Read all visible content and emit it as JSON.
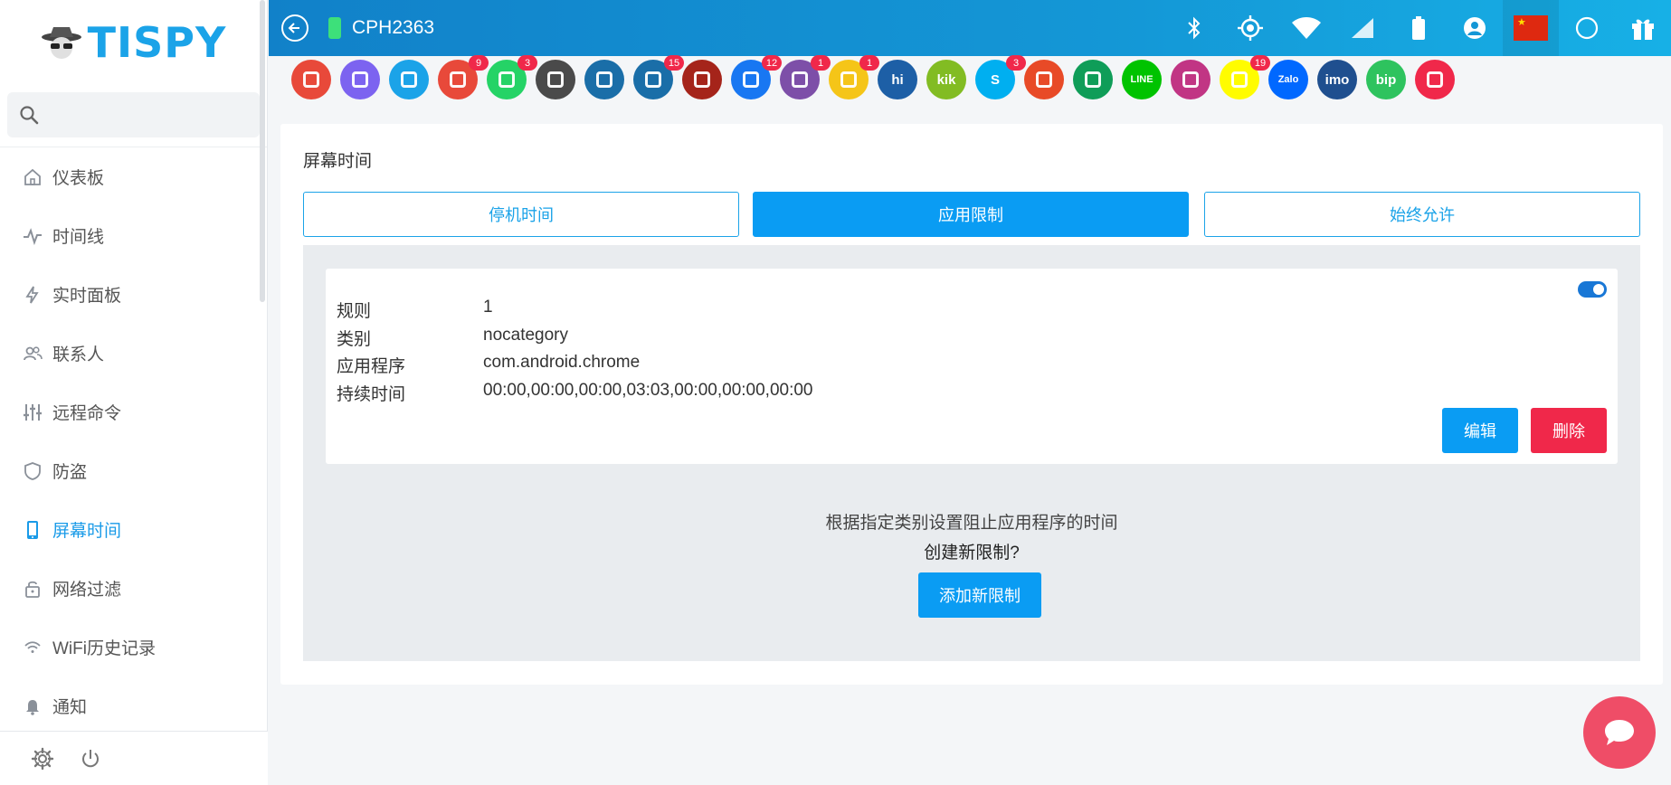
{
  "brand": {
    "name": "TISPY"
  },
  "search": {
    "placeholder": ""
  },
  "sidebar": {
    "items": [
      {
        "label": "仪表板",
        "icon": "home-icon"
      },
      {
        "label": "时间线",
        "icon": "pulse-icon"
      },
      {
        "label": "实时面板",
        "icon": "bolt-icon"
      },
      {
        "label": "联系人",
        "icon": "contacts-icon"
      },
      {
        "label": "远程命令",
        "icon": "sliders-icon"
      },
      {
        "label": "防盗",
        "icon": "shield-icon"
      },
      {
        "label": "屏幕时间",
        "icon": "phone-icon",
        "active": true
      },
      {
        "label": "网络过滤",
        "icon": "lock-icon"
      },
      {
        "label": "WiFi历史记录",
        "icon": "wifi-icon"
      },
      {
        "label": "通知",
        "icon": "bell-icon"
      }
    ]
  },
  "topbar": {
    "device_name": "CPH2363"
  },
  "apps": [
    {
      "name": "video-call",
      "color": "#e8493a",
      "badge": ""
    },
    {
      "name": "phone",
      "color": "#7c63f0",
      "badge": ""
    },
    {
      "name": "messages",
      "color": "#1ba3e8",
      "badge": ""
    },
    {
      "name": "photos",
      "color": "#e8493a",
      "badge": "9"
    },
    {
      "name": "whatsapp",
      "color": "#25d366",
      "badge": "3"
    },
    {
      "name": "keyboard",
      "color": "#4a4a4a",
      "badge": ""
    },
    {
      "name": "device",
      "color": "#1a6ea8",
      "badge": ""
    },
    {
      "name": "notifications",
      "color": "#1a6ea8",
      "badge": "15"
    },
    {
      "name": "browser",
      "color": "#a5241a",
      "badge": ""
    },
    {
      "name": "facebook",
      "color": "#1877f2",
      "badge": "12"
    },
    {
      "name": "viber",
      "color": "#7d4fa8",
      "badge": "1"
    },
    {
      "name": "email",
      "color": "#f5c518",
      "badge": "1"
    },
    {
      "name": "hike",
      "color": "#1d5fa6",
      "badge": "",
      "text": "hi"
    },
    {
      "name": "kik",
      "color": "#82bc23",
      "badge": "",
      "text": "kik"
    },
    {
      "name": "skype",
      "color": "#00aff0",
      "badge": "3",
      "text": "S"
    },
    {
      "name": "tinder",
      "color": "#e84a27",
      "badge": ""
    },
    {
      "name": "hangouts",
      "color": "#0f9d58",
      "badge": ""
    },
    {
      "name": "line",
      "color": "#00c300",
      "badge": "",
      "text": "LINE"
    },
    {
      "name": "instagram",
      "color": "#c13584",
      "badge": ""
    },
    {
      "name": "snapchat",
      "color": "#fffc00",
      "badge": "19"
    },
    {
      "name": "zalo",
      "color": "#0068ff",
      "badge": "",
      "text": "Zalo"
    },
    {
      "name": "imo",
      "color": "#1f4f8f",
      "badge": "",
      "text": "imo"
    },
    {
      "name": "bip",
      "color": "#2ec35e",
      "badge": "",
      "text": "bip"
    },
    {
      "name": "video-chat",
      "color": "#f0284a",
      "badge": ""
    }
  ],
  "page": {
    "title": "屏幕时间"
  },
  "tabs": [
    {
      "label": "停机时间",
      "active": false
    },
    {
      "label": "应用限制",
      "active": true
    },
    {
      "label": "始终允许",
      "active": false
    }
  ],
  "rule": {
    "rows": [
      {
        "key": "规则",
        "value": "1"
      },
      {
        "key": "类别",
        "value": "nocategory"
      },
      {
        "key": "应用程序",
        "value": "com.android.chrome"
      },
      {
        "key": "持续时间",
        "value": "00:00,00:00,00:00,03:03,00:00,00:00,00:00"
      }
    ],
    "enabled": true,
    "edit_label": "编辑",
    "delete_label": "删除"
  },
  "info": {
    "description": "根据指定类别设置阻止应用程序的时间",
    "question": "创建新限制?",
    "add_label": "添加新限制"
  }
}
